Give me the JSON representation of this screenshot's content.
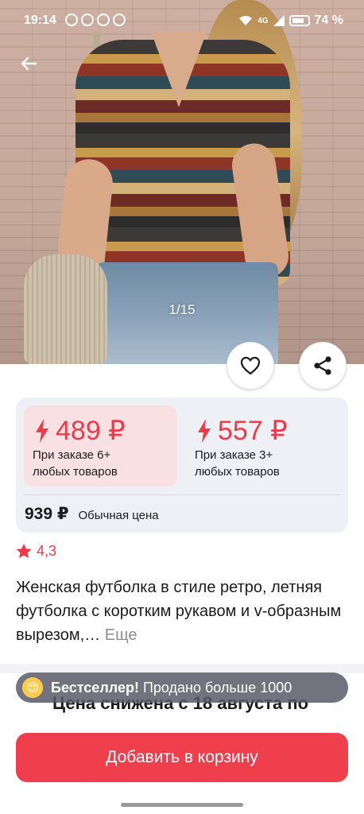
{
  "status_bar": {
    "time": "19:14",
    "network": "4G",
    "battery": "74 %"
  },
  "gallery": {
    "counter": "1/15"
  },
  "prices": {
    "tiers": [
      {
        "price": "489 ₽",
        "condition_line1": "При заказе 6+",
        "condition_line2": "любых товаров"
      },
      {
        "price": "557 ₽",
        "condition_line1": "При заказе 3+",
        "condition_line2": "любых товаров"
      }
    ],
    "regular_price": "939 ₽",
    "regular_label": "Обычная цена"
  },
  "rating": {
    "value": "4,3"
  },
  "product": {
    "title": "Женская футболка в стиле ретро, летняя футболка с коротким рукавом и v-образным вырезом,…",
    "more": "Еще"
  },
  "promo": {
    "text": "Цена снижена с 18 августа по"
  },
  "badge": {
    "bold": "Бестселлер!",
    "text": "Продано больше 1000"
  },
  "actions": {
    "add_to_cart": "Добавить в корзину"
  },
  "colors": {
    "accent": "#ef3f4d",
    "tier_active_bg": "#f9e1e3",
    "card_bg": "#eff0f5"
  }
}
